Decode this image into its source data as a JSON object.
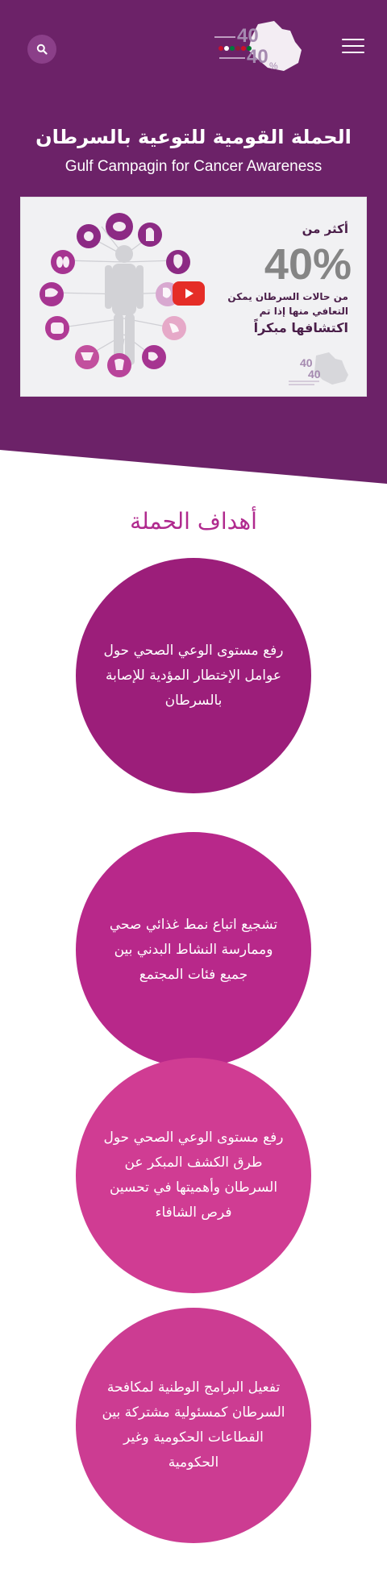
{
  "header": {
    "search_icon": "search-icon",
    "menu_icon": "hamburger-menu-icon",
    "logo": {
      "number_top": "40",
      "number_bottom": "40",
      "percent": "%"
    }
  },
  "hero": {
    "title_ar": "الحملة القومية للتوعية بالسرطان",
    "title_en": "Gulf Campagin for Cancer Awareness",
    "bg_color": "#6c2268"
  },
  "video": {
    "line1": "أكثر من",
    "stat": "40%",
    "line2": "من حالات السرطان يمكن",
    "line3": "التعافي منها إذا تم",
    "line4": "اكتشافها مبكراً",
    "play_icon": "youtube-play-icon"
  },
  "goals": {
    "title": "أهداف الحملة",
    "items": [
      {
        "text": "رفع مستوى الوعي الصحي حول عوامل الإختطار المؤدية للإصابة بالسرطان",
        "color": "#9c1e7a"
      },
      {
        "text": "تشجيع اتباع نمط غذائي صحي وممارسة النشاط البدني بين جميع فئات المجتمع",
        "color": "#b8288a"
      },
      {
        "text": "رفع مستوى الوعي الصحي حول طرق الكشف المبكر عن السرطان وأهميتها في تحسين فرص الشافاء",
        "color": "#d03c93"
      },
      {
        "text": "تفعيل البرامج الوطنية لمكافحة السرطان كمسئولية مشتركة بين القطاعات الحكومية وغير الحكومية",
        "color": "#cc3c92"
      }
    ]
  }
}
